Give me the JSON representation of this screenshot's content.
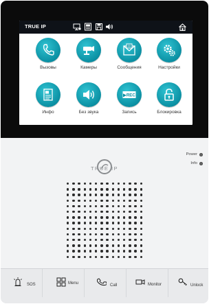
{
  "screen": {
    "brand": "TRUE IP",
    "status_icons": [
      "monitor-icon",
      "intercom-icon",
      "save-icon",
      "volume-icon"
    ],
    "tiles": [
      {
        "label": "Вызовы",
        "icon": "phone-icon"
      },
      {
        "label": "Камеры",
        "icon": "camera-icon"
      },
      {
        "label": "Сообщения",
        "icon": "message-icon"
      },
      {
        "label": "Настройки",
        "icon": "settings-icon"
      },
      {
        "label": "Инфо",
        "icon": "info-doc-icon"
      },
      {
        "label": "Без звука",
        "icon": "mute-icon"
      },
      {
        "label": "Запись",
        "icon": "record-icon",
        "badge": "▶REC"
      },
      {
        "label": "Блокировка",
        "icon": "lock-icon"
      }
    ]
  },
  "device": {
    "brand": "TRUE IP",
    "indicators": {
      "power": "Power",
      "info": "Info"
    }
  },
  "buttons": [
    {
      "label": "SOS"
    },
    {
      "label": "Menu"
    },
    {
      "label": "Call"
    },
    {
      "label": "Monitor"
    },
    {
      "label": "Unlock"
    }
  ],
  "colors": {
    "tile_accent": "#0b90a3",
    "bezel": "#0b0b0b"
  }
}
